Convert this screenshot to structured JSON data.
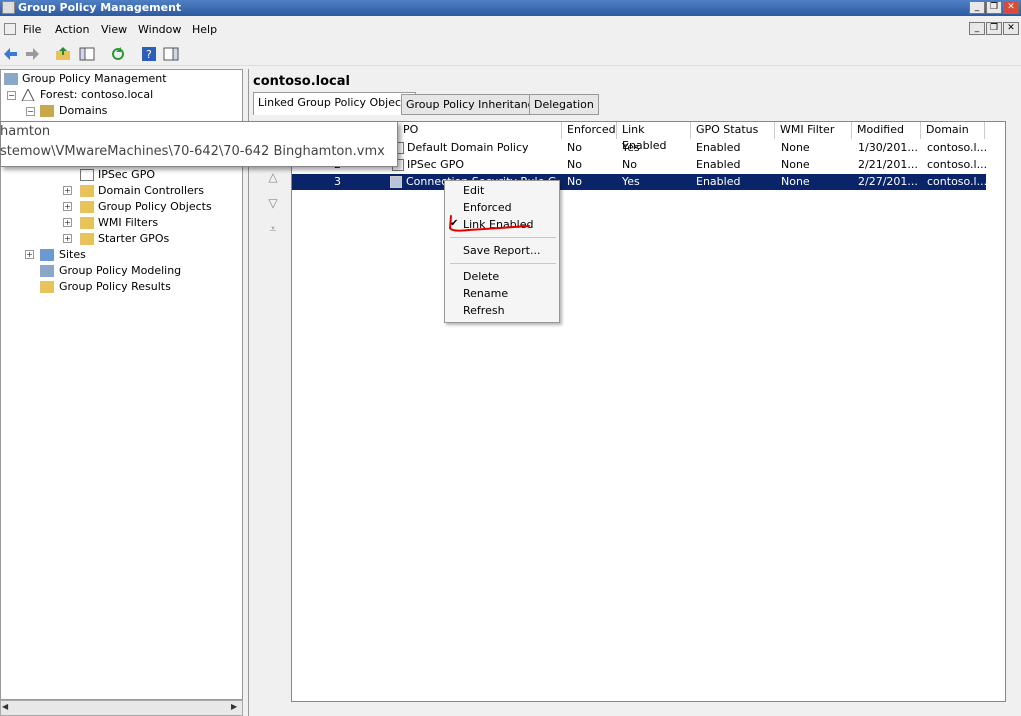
{
  "window": {
    "title": "Group Policy Management"
  },
  "menu": [
    "File",
    "Action",
    "View",
    "Window",
    "Help"
  ],
  "tree": {
    "root": "Group Policy Management",
    "forest": "Forest: contoso.local",
    "domains": "Domains",
    "items": [
      "IPSec GPO",
      "Domain Controllers",
      "Group Policy Objects",
      "WMI Filters",
      "Starter GPOs"
    ],
    "sites": "Sites",
    "modeling": "Group Policy Modeling",
    "results": "Group Policy Results"
  },
  "tooltip": {
    "line1": "hamton",
    "line2": "stemow\\VMwareMachines\\70-642\\70-642 Binghamton.vmx"
  },
  "main": {
    "title": "contoso.local",
    "tabs": [
      "Linked Group Policy Objects",
      "Group Policy Inheritance",
      "Delegation"
    ]
  },
  "table": {
    "columns": [
      "PO",
      "Enforced",
      "Link Enabled",
      "GPO Status",
      "WMI Filter",
      "Modified",
      "Domain"
    ],
    "rows": [
      {
        "order": "",
        "gpo": "Default Domain Policy",
        "enforced": "No",
        "link_enabled": "Yes",
        "status": "Enabled",
        "wmi": "None",
        "modified": "1/30/201...",
        "domain": "contoso.l..."
      },
      {
        "order": "2",
        "gpo": "IPSec GPO",
        "enforced": "No",
        "link_enabled": "No",
        "status": "Enabled",
        "wmi": "None",
        "modified": "2/21/201...",
        "domain": "contoso.l..."
      },
      {
        "order": "3",
        "gpo": "Connection Security Rule GPO",
        "enforced": "No",
        "link_enabled": "Yes",
        "status": "Enabled",
        "wmi": "None",
        "modified": "2/27/201...",
        "domain": "contoso.l..."
      }
    ]
  },
  "context_menu": {
    "items": [
      "Edit",
      "Enforced",
      "Link Enabled",
      "Save Report...",
      "Delete",
      "Rename",
      "Refresh"
    ],
    "checked": "Link Enabled",
    "check_glyph": "✔"
  },
  "colors": {
    "selection": "#0a246a",
    "annotation": "#e00000"
  }
}
